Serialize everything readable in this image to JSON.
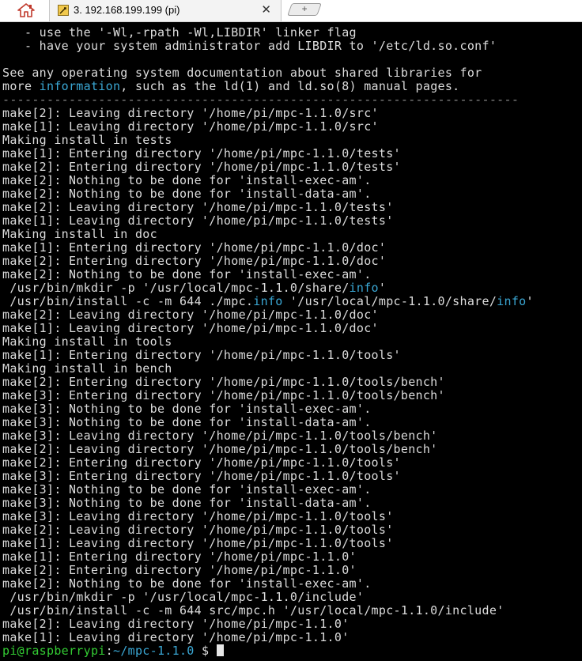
{
  "tab": {
    "title": "3. 192.168.199.199 (pi)",
    "close_label": "✕",
    "new_tab_label": "+"
  },
  "terminal": {
    "lines": [
      [
        {
          "t": "   - use the '-Wl,-rpath -Wl,LIBDIR' linker flag"
        }
      ],
      [
        {
          "t": "   - have your system administrator add LIBDIR to '/etc/ld.so.conf'"
        }
      ],
      [
        {
          "t": ""
        }
      ],
      [
        {
          "t": "See any operating system documentation about shared libraries for"
        }
      ],
      [
        {
          "t": "more "
        },
        {
          "t": "information",
          "c": "seg-hl"
        },
        {
          "t": ", such as the ld(1) and ld.so(8) manual pages."
        }
      ],
      [
        {
          "t": "----------------------------------------------------------------------",
          "c": "seg-dashed"
        }
      ],
      [
        {
          "t": "make[2]: Leaving directory '/home/pi/mpc-1.1.0/src'"
        }
      ],
      [
        {
          "t": "make[1]: Leaving directory '/home/pi/mpc-1.1.0/src'"
        }
      ],
      [
        {
          "t": "Making install in tests"
        }
      ],
      [
        {
          "t": "make[1]: Entering directory '/home/pi/mpc-1.1.0/tests'"
        }
      ],
      [
        {
          "t": "make[2]: Entering directory '/home/pi/mpc-1.1.0/tests'"
        }
      ],
      [
        {
          "t": "make[2]: Nothing to be done for 'install-exec-am'."
        }
      ],
      [
        {
          "t": "make[2]: Nothing to be done for 'install-data-am'."
        }
      ],
      [
        {
          "t": "make[2]: Leaving directory '/home/pi/mpc-1.1.0/tests'"
        }
      ],
      [
        {
          "t": "make[1]: Leaving directory '/home/pi/mpc-1.1.0/tests'"
        }
      ],
      [
        {
          "t": "Making install in doc"
        }
      ],
      [
        {
          "t": "make[1]: Entering directory '/home/pi/mpc-1.1.0/doc'"
        }
      ],
      [
        {
          "t": "make[2]: Entering directory '/home/pi/mpc-1.1.0/doc'"
        }
      ],
      [
        {
          "t": "make[2]: Nothing to be done for 'install-exec-am'."
        }
      ],
      [
        {
          "t": " /usr/bin/mkdir -p '/usr/local/mpc-1.1.0/share/"
        },
        {
          "t": "info",
          "c": "seg-hl"
        },
        {
          "t": "'"
        }
      ],
      [
        {
          "t": " /usr/bin/install -c -m 644 ./mpc."
        },
        {
          "t": "info",
          "c": "seg-hl"
        },
        {
          "t": " '/usr/local/mpc-1.1.0/share/"
        },
        {
          "t": "info",
          "c": "seg-hl"
        },
        {
          "t": "'"
        }
      ],
      [
        {
          "t": "make[2]: Leaving directory '/home/pi/mpc-1.1.0/doc'"
        }
      ],
      [
        {
          "t": "make[1]: Leaving directory '/home/pi/mpc-1.1.0/doc'"
        }
      ],
      [
        {
          "t": "Making install in tools"
        }
      ],
      [
        {
          "t": "make[1]: Entering directory '/home/pi/mpc-1.1.0/tools'"
        }
      ],
      [
        {
          "t": "Making install in bench"
        }
      ],
      [
        {
          "t": "make[2]: Entering directory '/home/pi/mpc-1.1.0/tools/bench'"
        }
      ],
      [
        {
          "t": "make[3]: Entering directory '/home/pi/mpc-1.1.0/tools/bench'"
        }
      ],
      [
        {
          "t": "make[3]: Nothing to be done for 'install-exec-am'."
        }
      ],
      [
        {
          "t": "make[3]: Nothing to be done for 'install-data-am'."
        }
      ],
      [
        {
          "t": "make[3]: Leaving directory '/home/pi/mpc-1.1.0/tools/bench'"
        }
      ],
      [
        {
          "t": "make[2]: Leaving directory '/home/pi/mpc-1.1.0/tools/bench'"
        }
      ],
      [
        {
          "t": "make[2]: Entering directory '/home/pi/mpc-1.1.0/tools'"
        }
      ],
      [
        {
          "t": "make[3]: Entering directory '/home/pi/mpc-1.1.0/tools'"
        }
      ],
      [
        {
          "t": "make[3]: Nothing to be done for 'install-exec-am'."
        }
      ],
      [
        {
          "t": "make[3]: Nothing to be done for 'install-data-am'."
        }
      ],
      [
        {
          "t": "make[3]: Leaving directory '/home/pi/mpc-1.1.0/tools'"
        }
      ],
      [
        {
          "t": "make[2]: Leaving directory '/home/pi/mpc-1.1.0/tools'"
        }
      ],
      [
        {
          "t": "make[1]: Leaving directory '/home/pi/mpc-1.1.0/tools'"
        }
      ],
      [
        {
          "t": "make[1]: Entering directory '/home/pi/mpc-1.1.0'"
        }
      ],
      [
        {
          "t": "make[2]: Entering directory '/home/pi/mpc-1.1.0'"
        }
      ],
      [
        {
          "t": "make[2]: Nothing to be done for 'install-exec-am'."
        }
      ],
      [
        {
          "t": " /usr/bin/mkdir -p '/usr/local/mpc-1.1.0/include'"
        }
      ],
      [
        {
          "t": " /usr/bin/install -c -m 644 src/mpc.h '/usr/local/mpc-1.1.0/include'"
        }
      ],
      [
        {
          "t": "make[2]: Leaving directory '/home/pi/mpc-1.1.0'"
        }
      ],
      [
        {
          "t": "make[1]: Leaving directory '/home/pi/mpc-1.1.0'"
        }
      ]
    ],
    "prompt": {
      "user_host": "pi@raspberrypi",
      "sep": ":",
      "path": "~/mpc-1.1.0",
      "symbol": " $ "
    }
  },
  "colors": {
    "background": "#000000",
    "text": "#dcdcdc",
    "highlight": "#3aa7d4",
    "prompt_user": "#33cc33"
  }
}
